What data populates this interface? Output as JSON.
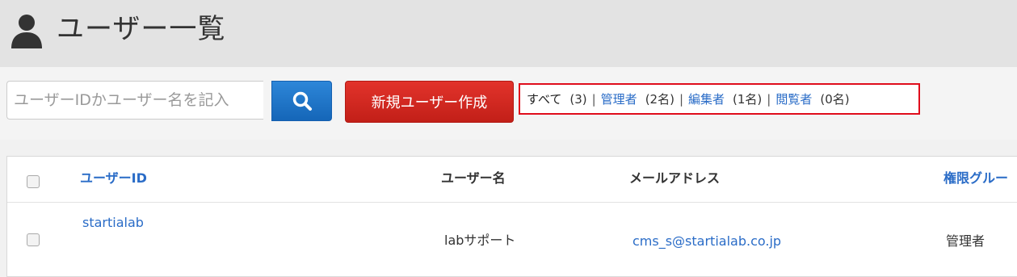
{
  "header": {
    "title": "ユーザー一覧",
    "icon": "user-icon"
  },
  "toolbar": {
    "search": {
      "placeholder": "ユーザーIDかユーザー名を記入",
      "value": "",
      "button_icon": "search-icon",
      "button_color": "#1a6fc4"
    },
    "create_button_label": "新規ユーザー作成",
    "create_button_color": "#d1261f",
    "filters": [
      {
        "label": "すべて",
        "count": "(3)",
        "active": true
      },
      {
        "label": "管理者",
        "count": "(2名)",
        "active": false
      },
      {
        "label": "編集者",
        "count": "(1名)",
        "active": false
      },
      {
        "label": "閲覧者",
        "count": "(0名)",
        "active": false
      }
    ],
    "filter_separator": "|",
    "highlight_color": "#e00d1c"
  },
  "table": {
    "columns": [
      "ユーザーID",
      "ユーザー名",
      "メールアドレス",
      "権限グルー"
    ],
    "rows": [
      {
        "user_id": "startialab",
        "user_name": "labサポート",
        "email": "cms_s@startialab.co.jp",
        "group": "管理者"
      }
    ]
  },
  "colors": {
    "link": "#2a6cc7",
    "header_bg": "#e3e3e3"
  }
}
